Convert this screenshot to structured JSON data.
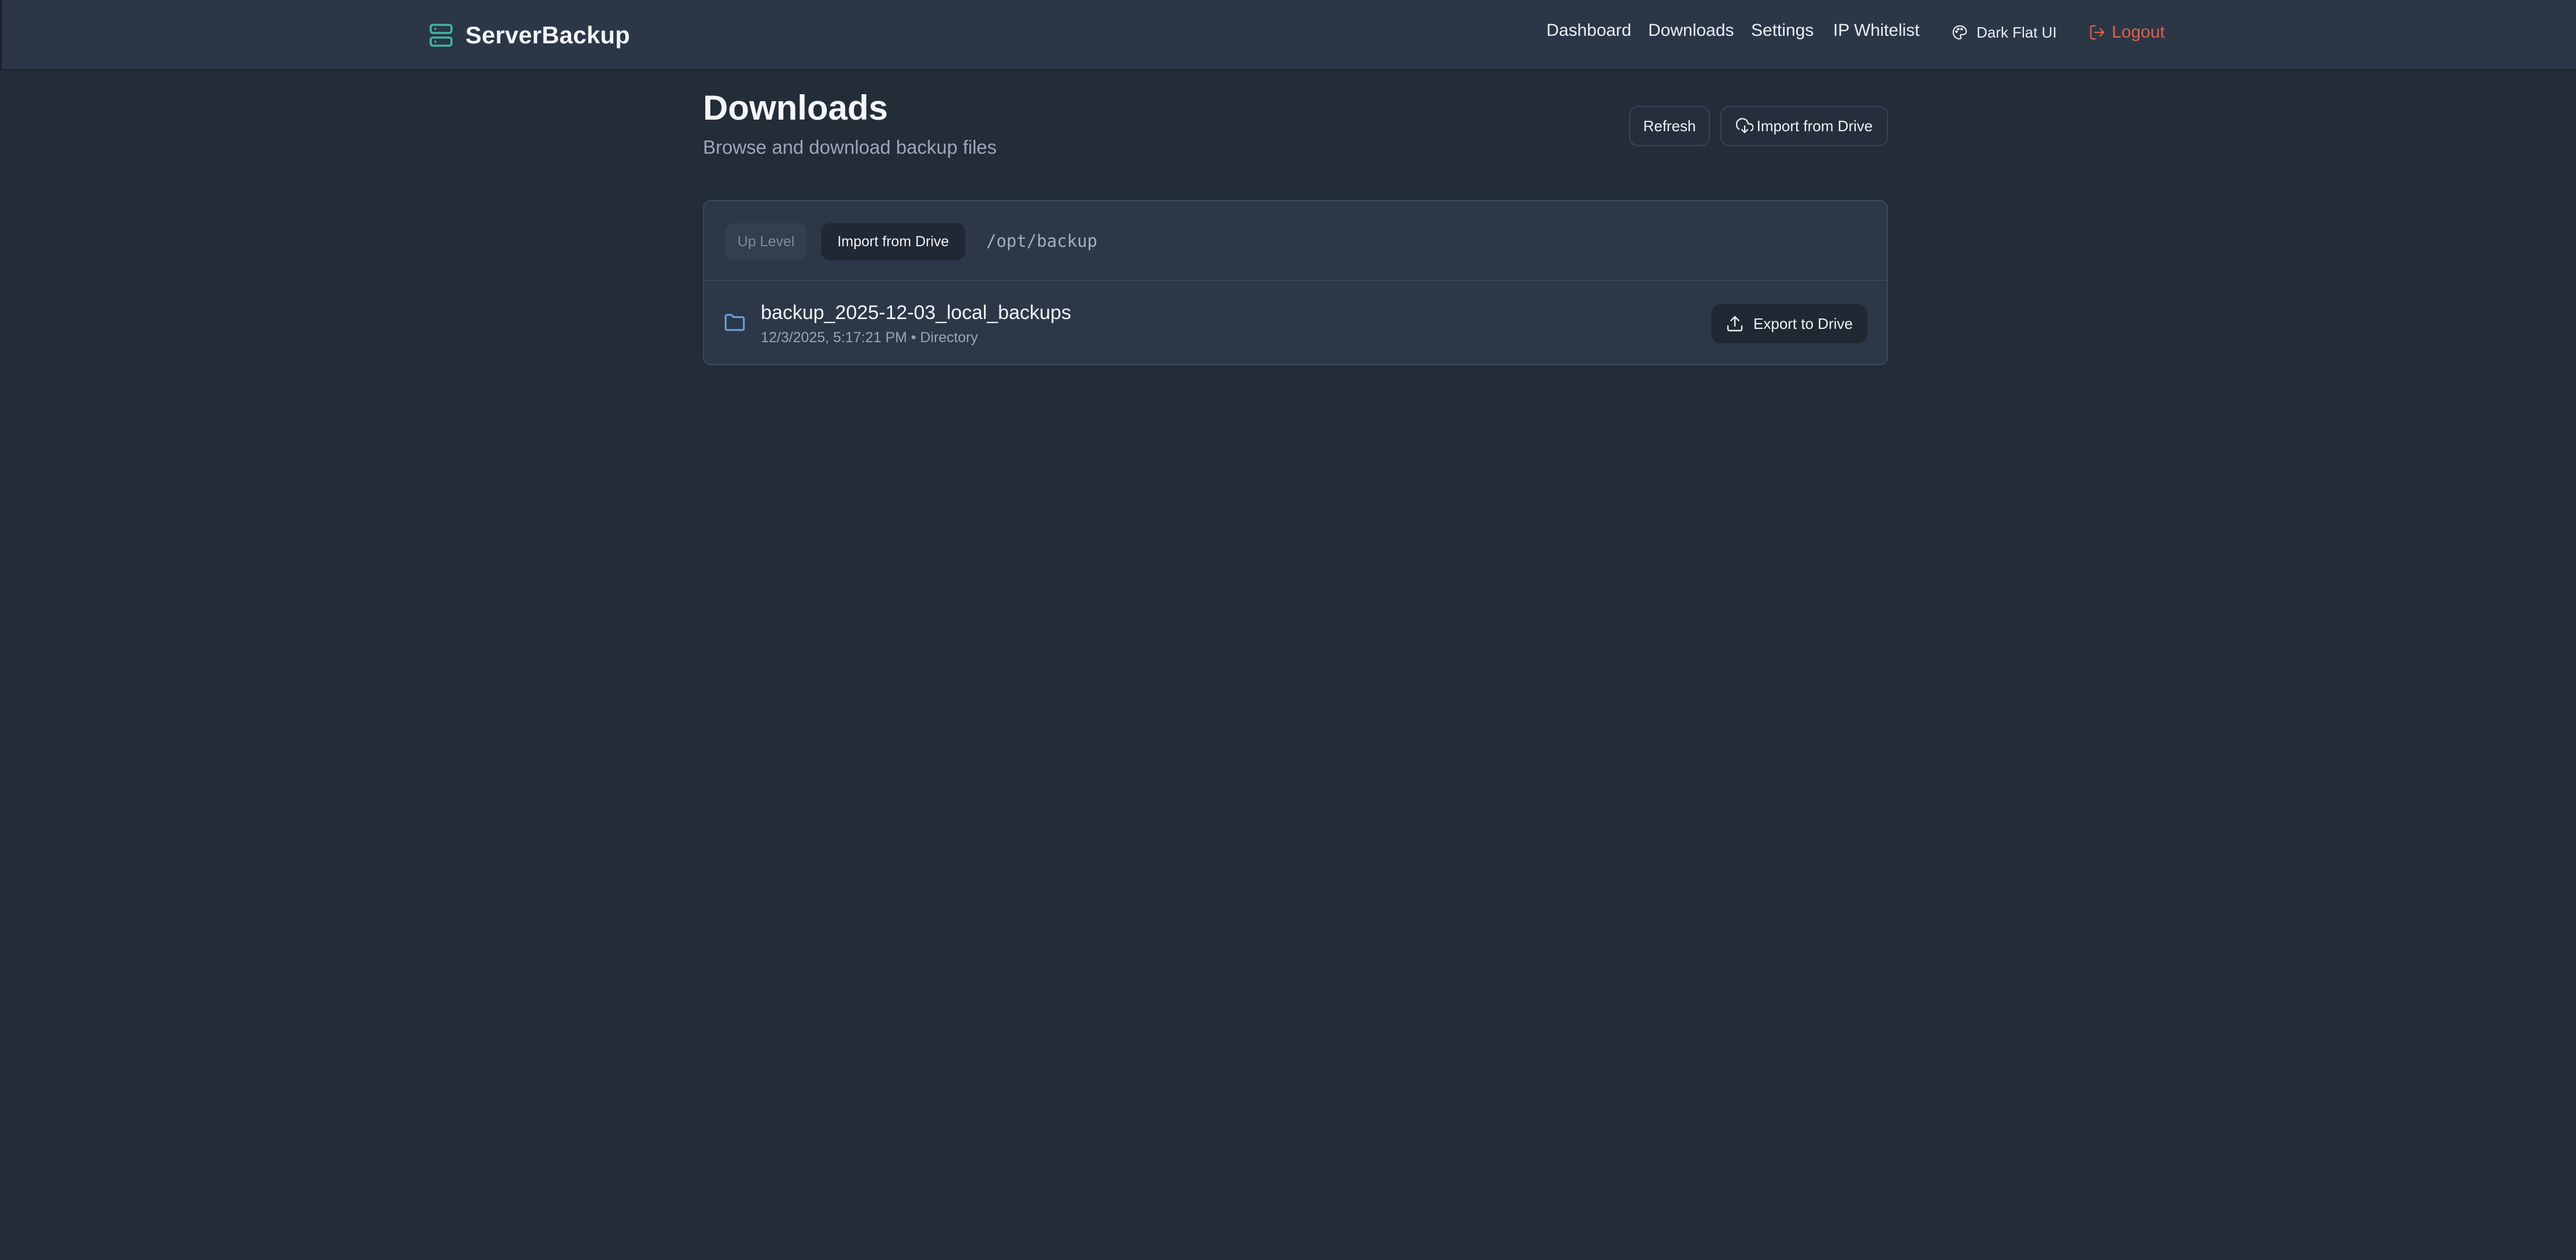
{
  "app": {
    "name": "ServerBackup",
    "logo_icon": "server-icon",
    "accent_color": "#3fb5a8"
  },
  "nav": {
    "links": [
      "Dashboard",
      "Downloads",
      "Settings",
      "IP Whitelist"
    ],
    "theme_label": "Dark Flat UI",
    "theme_icon": "palette-icon",
    "logout_label": "Logout",
    "logout_icon": "logout-icon",
    "logout_color": "#e0604c"
  },
  "page": {
    "title": "Downloads",
    "subtitle": "Browse and download backup files",
    "refresh_label": "Refresh",
    "import_label": "Import from Drive",
    "import_icon": "cloud-download-icon"
  },
  "browser": {
    "up_level_label": "Up Level",
    "import_label": "Import from Drive",
    "current_path": "/opt/backup",
    "entries": [
      {
        "name": "backup_2025-12-03_local_backups",
        "meta": "12/3/2025, 5:17:21 PM • Directory",
        "icon": "folder-icon",
        "action_label": "Export to Drive",
        "action_icon": "upload-icon"
      }
    ]
  }
}
